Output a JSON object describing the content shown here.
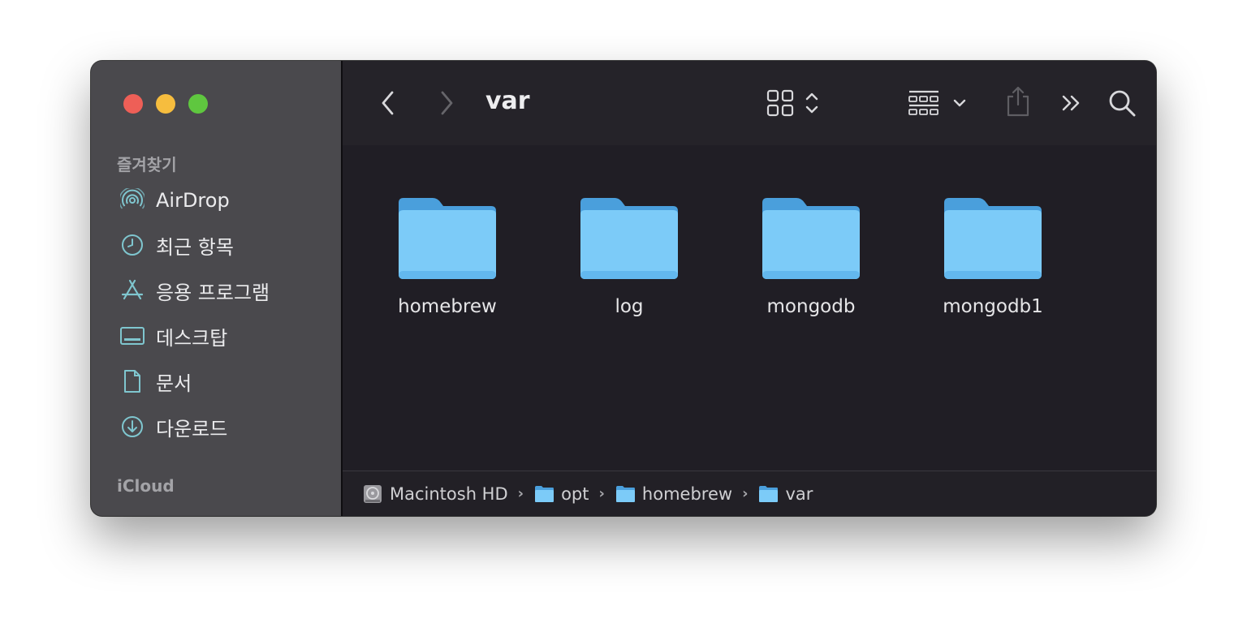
{
  "window": {
    "title": "var"
  },
  "sidebar": {
    "favorites_header": "즐겨찾기",
    "items": [
      {
        "label": "AirDrop",
        "icon": "airdrop-icon"
      },
      {
        "label": "최근 항목",
        "icon": "clock-icon"
      },
      {
        "label": "응용 프로그램",
        "icon": "applications-icon"
      },
      {
        "label": "데스크탑",
        "icon": "desktop-icon"
      },
      {
        "label": "문서",
        "icon": "document-icon"
      },
      {
        "label": "다운로드",
        "icon": "download-icon"
      }
    ],
    "icloud_header": "iCloud"
  },
  "toolbar": {
    "icons": [
      "back-icon",
      "forward-icon",
      "grid-view-icon",
      "group-icon",
      "share-icon",
      "more-icon",
      "search-icon"
    ]
  },
  "folders": [
    {
      "name": "homebrew"
    },
    {
      "name": "log"
    },
    {
      "name": "mongodb"
    },
    {
      "name": "mongodb1"
    }
  ],
  "pathbar": {
    "items": [
      {
        "label": "Macintosh HD",
        "icon": "disk-icon"
      },
      {
        "label": "opt",
        "icon": "folder-icon"
      },
      {
        "label": "homebrew",
        "icon": "folder-icon"
      },
      {
        "label": "var",
        "icon": "folder-icon"
      }
    ],
    "separator": "›"
  },
  "colors": {
    "sidebar_bg": "#4a494d",
    "main_bg": "#201e25",
    "folder_blue": "#7ccbf8",
    "close": "#ee5f57",
    "minimize": "#f6bd3e",
    "zoom": "#5fc73f"
  }
}
